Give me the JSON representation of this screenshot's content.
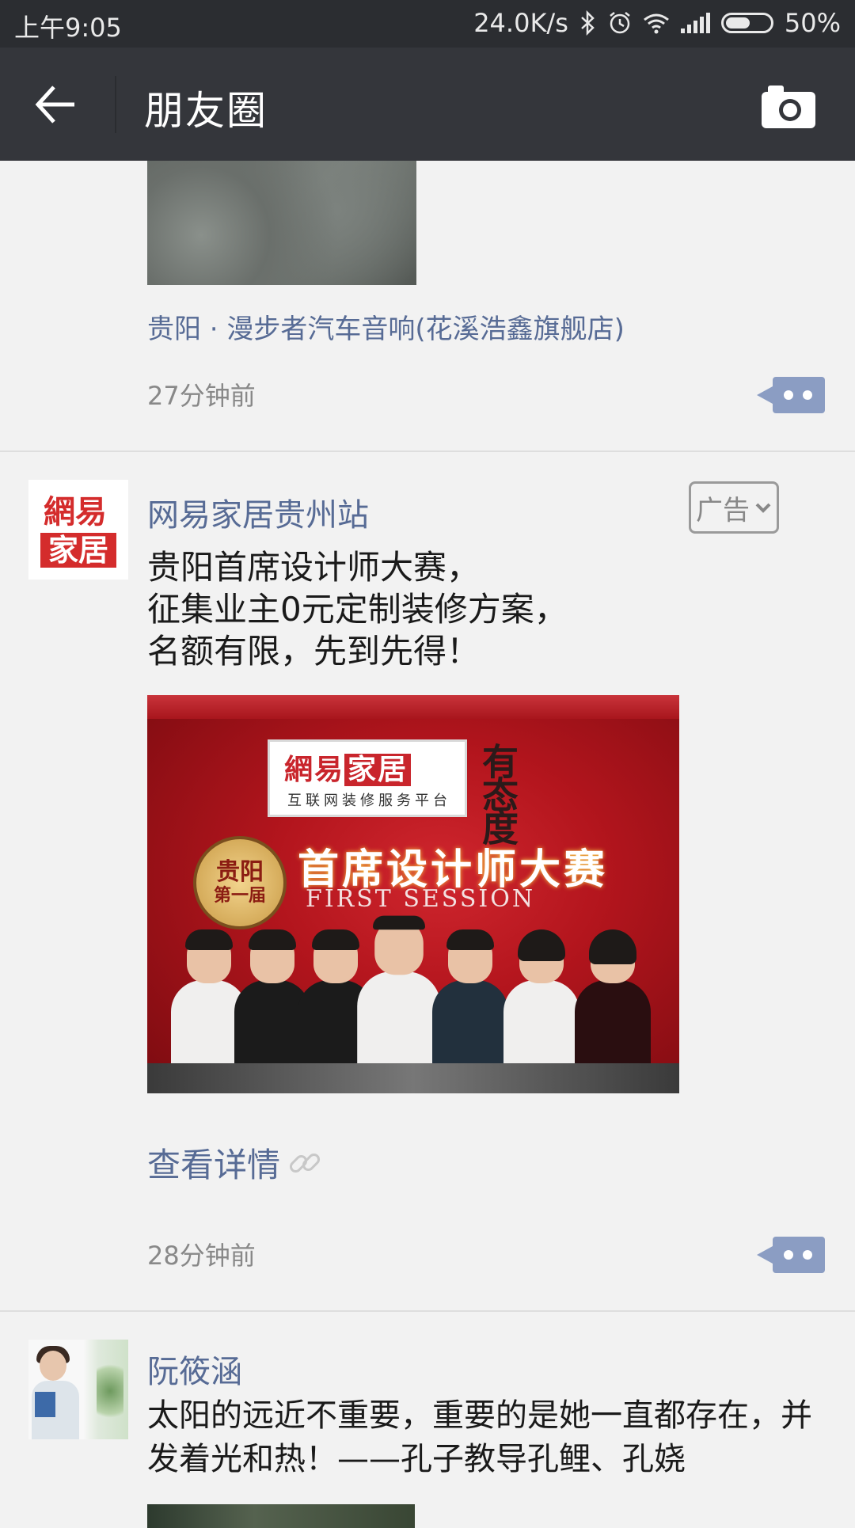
{
  "status_bar": {
    "time": "上午9:05",
    "net_speed": "24.0K/s",
    "battery": "50%",
    "icons": [
      "bluetooth-icon",
      "alarm-icon",
      "wifi-icon",
      "signal-icon",
      "battery-icon"
    ]
  },
  "title_bar": {
    "title": "朋友圈",
    "back_icon": "back-arrow-icon",
    "camera_icon": "camera-icon"
  },
  "posts": [
    {
      "location": "贵阳 · 漫步者汽车音响(花溪浩鑫旗舰店)",
      "time": "27分钟前"
    },
    {
      "avatar_text_top": "網易",
      "avatar_text_bottom": "家居",
      "username": "网易家居贵州站",
      "ad_tag": "广告",
      "text": "贵阳首席设计师大赛，\n征集业主0元定制装修方案，\n名额有限，先到先得！",
      "banner": {
        "brand_prefix": "網易",
        "brand_highlight": "家居",
        "brand_sub": "互联网装修服务平台",
        "attitude": "有态度",
        "seal_top": "贵阳",
        "seal_bottom": "第一届",
        "headline": "首席设计师大赛",
        "sub_headline": "FIRST SESSION"
      },
      "details_link": "查看详情",
      "time": "28分钟前"
    },
    {
      "username": "阮筱涵",
      "text": "太阳的远近不重要，重要的是她一直都存在，并发着光和热！——孔子教导孔鲤、孔娆"
    }
  ],
  "colors": {
    "link": "#576b95",
    "titlebar": "#34363b",
    "statusbar": "#2b2d31",
    "background": "#f2f2f2",
    "comment_button": "#8b9dc3"
  }
}
